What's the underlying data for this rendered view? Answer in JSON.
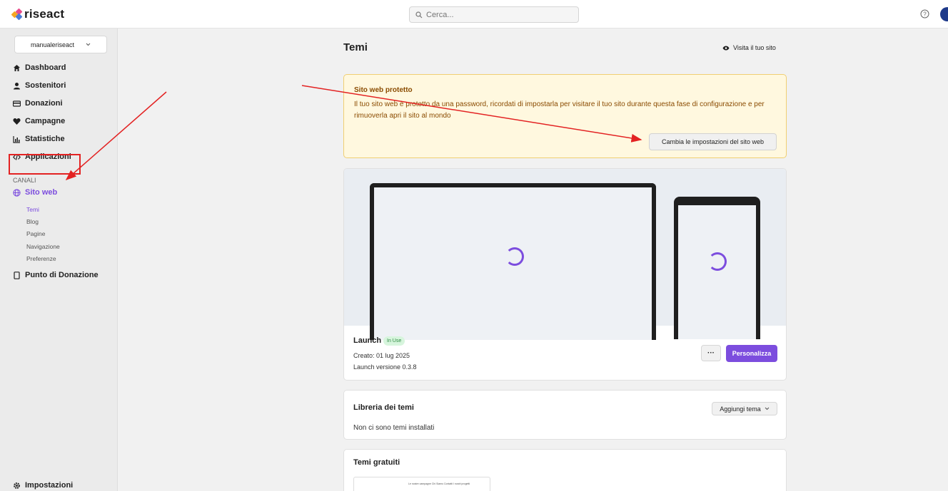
{
  "app": {
    "name": "riseact"
  },
  "search": {
    "placeholder": "Cerca..."
  },
  "sidebar": {
    "store": "manualeriseact",
    "items": [
      {
        "label": "Dashboard",
        "icon": "home-icon"
      },
      {
        "label": "Sostenitori",
        "icon": "user-icon"
      },
      {
        "label": "Donazioni",
        "icon": "card-icon"
      },
      {
        "label": "Campagne",
        "icon": "heart-icon"
      },
      {
        "label": "Statistiche",
        "icon": "chart-icon"
      },
      {
        "label": "Applicazioni",
        "icon": "code-icon"
      }
    ],
    "section_label": "CANALI",
    "channel": {
      "label": "Sito web",
      "icon": "globe-icon"
    },
    "sub_items": [
      "Temi",
      "Blog",
      "Pagine",
      "Navigazione",
      "Preferenze"
    ],
    "pos": {
      "label": "Punto di Donazione",
      "icon": "tablet-icon"
    },
    "settings": {
      "label": "Impostazioni",
      "icon": "gear-icon"
    }
  },
  "main": {
    "title": "Temi",
    "visit_link": "Visita il tuo sito",
    "warning": {
      "title": "Sito web protetto",
      "text": "Il tuo sito web è protetto da una password, ricordati di impostarla per visitare il tuo sito durante questa fase di configurazione e per rimuoverla apri il sito al mondo",
      "button": "Cambia le impostazioni del sito web"
    },
    "current_theme": {
      "name": "Launch",
      "badge": "In Use",
      "created": "Creato: 01 lug 2025",
      "version": "Launch versione 0.3.8",
      "more_button": "···",
      "customize_button": "Personalizza"
    },
    "library": {
      "title": "Libreria dei temi",
      "empty_text": "Non ci sono temi installati",
      "add_button": "Aggiungi tema"
    },
    "free_themes": {
      "title": "Temi gratuiti",
      "thumb_nav": "Le nostre campagne    Chi Siamo    Contatti    I nostri progetti"
    }
  },
  "colors": {
    "accent": "#7c4dde",
    "annotation_red": "#e32222",
    "warning_bg": "#fff8df",
    "warning_text": "#8a4b00"
  }
}
